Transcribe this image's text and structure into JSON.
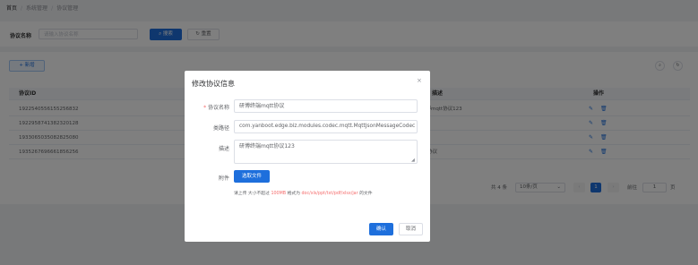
{
  "breadcrumb": {
    "home": "首页",
    "parent": "系统管理",
    "current": "协议管理"
  },
  "search": {
    "name_label": "协议名称",
    "name_placeholder": "请输入协议名称",
    "search_button": "搜索",
    "reset_button": "重置"
  },
  "toolbar": {
    "add_button": "新增"
  },
  "table": {
    "columns": {
      "id": "协议ID",
      "desc": "描述",
      "ops": "操作"
    },
    "rows": [
      {
        "id": "1922540556155256832",
        "desc": "研博mqtt协议123"
      },
      {
        "id": "1922958741382320128",
        "desc": ""
      },
      {
        "id": "1933065035082825080",
        "desc": ""
      },
      {
        "id": "1935267696661856256",
        "desc": "iot协议"
      }
    ]
  },
  "pagination": {
    "total": "共 4 条",
    "page_size": "10条/页",
    "current_page": "1",
    "goto_label": "前往",
    "goto_value": "1",
    "page_suffix": "页"
  },
  "dialog": {
    "title": "修改协议信息",
    "close": "×",
    "fields": {
      "name_label": "协议名称",
      "name_value": "研博终端mqtt协议",
      "class_label": "类路径",
      "class_value": "com.yanboot.edge.biz.modules.codec.mqtt.MqttJsonMessageCodec",
      "desc_label": "描述",
      "desc_value": "研博终端mqtt协议123",
      "attach_label": "附件",
      "choose_file": "选取文件"
    },
    "hint": {
      "prefix": "请上传 大小不超过",
      "size": "100MB",
      "mid": "格式为",
      "formats": "doc/xls/ppt/txt/pdf/xlsx/jar",
      "suffix": "的文件"
    },
    "confirm": "确认",
    "cancel": "取消"
  },
  "colors": {
    "primary": "#1e6fdc",
    "danger": "#f56c6c"
  }
}
